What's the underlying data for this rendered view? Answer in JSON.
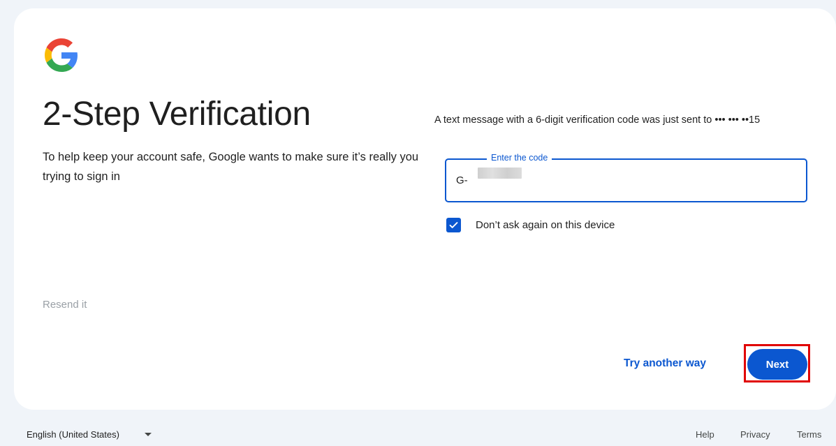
{
  "logo": {
    "icon": "google-g-icon",
    "colors": {
      "blue": "#4285F4",
      "red": "#EA4335",
      "yellow": "#FBBC05",
      "green": "#34A853"
    }
  },
  "page": {
    "title": "2-Step Verification",
    "subtitle": "To help keep your account safe, Google wants to make sure it’s really you trying to sign in",
    "resend_label": "Resend it"
  },
  "verification": {
    "message": "A text message with a 6-digit verification code was just sent to ••• ••• ••15",
    "field_label": "Enter the code",
    "field_prefix": "G-",
    "field_value": "",
    "remember_label": "Don’t ask again on this device",
    "remember_checked": true
  },
  "actions": {
    "try_another_label": "Try another way",
    "next_label": "Next"
  },
  "footer": {
    "language": "English (United States)",
    "help": "Help",
    "privacy": "Privacy",
    "terms": "Terms"
  },
  "colors": {
    "accent": "#0b57d0",
    "background": "#f0f4f9",
    "highlight": "#e00000"
  }
}
